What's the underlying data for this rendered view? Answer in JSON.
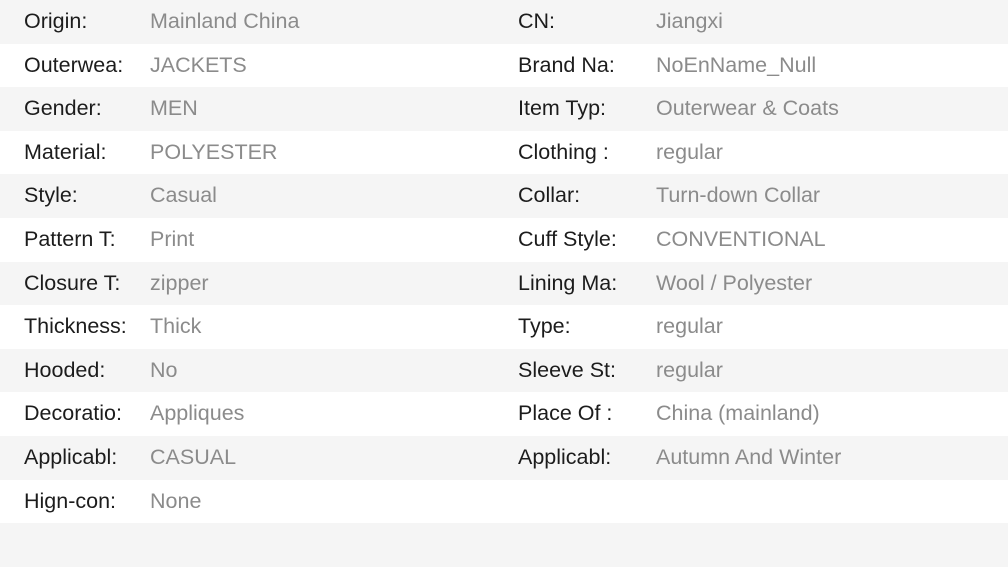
{
  "table": {
    "columns": 2,
    "row_count": 13,
    "colors": {
      "stripe_background": "#f5f5f5",
      "row_background": "#ffffff",
      "label_text": "#1c1c1c",
      "value_text": "#8b8b8b"
    },
    "rows": [
      {
        "left": {
          "label": "Origin:",
          "value": "Mainland China"
        },
        "right": {
          "label": "CN:",
          "value": "Jiangxi"
        }
      },
      {
        "left": {
          "label": "Outerwea:",
          "value": "JACKETS"
        },
        "right": {
          "label": "Brand Na:",
          "value": "NoEnName_Null"
        }
      },
      {
        "left": {
          "label": "Gender:",
          "value": "MEN"
        },
        "right": {
          "label": "Item Typ:",
          "value": "Outerwear & Coats"
        }
      },
      {
        "left": {
          "label": "Material:",
          "value": "POLYESTER"
        },
        "right": {
          "label": "Clothing :",
          "value": "regular"
        }
      },
      {
        "left": {
          "label": "Style:",
          "value": "Casual"
        },
        "right": {
          "label": "Collar:",
          "value": "Turn-down Collar"
        }
      },
      {
        "left": {
          "label": "Pattern T:",
          "value": "Print"
        },
        "right": {
          "label": "Cuff Style:",
          "value": "CONVENTIONAL"
        }
      },
      {
        "left": {
          "label": "Closure T:",
          "value": "zipper"
        },
        "right": {
          "label": "Lining Ma:",
          "value": "Wool / Polyester"
        }
      },
      {
        "left": {
          "label": "Thickness:",
          "value": "Thick"
        },
        "right": {
          "label": "Type:",
          "value": "regular"
        }
      },
      {
        "left": {
          "label": "Hooded:",
          "value": "No"
        },
        "right": {
          "label": "Sleeve St:",
          "value": "regular"
        }
      },
      {
        "left": {
          "label": "Decoratio:",
          "value": "Appliques"
        },
        "right": {
          "label": "Place Of :",
          "value": "China (mainland)"
        }
      },
      {
        "left": {
          "label": "Applicabl:",
          "value": "CASUAL"
        },
        "right": {
          "label": "Applicabl:",
          "value": "Autumn And Winter"
        }
      },
      {
        "left": {
          "label": "Hign-con:",
          "value": "None"
        },
        "right": {
          "label": "",
          "value": ""
        }
      },
      {
        "left": {
          "label": "",
          "value": ""
        },
        "right": {
          "label": "",
          "value": ""
        }
      }
    ]
  }
}
